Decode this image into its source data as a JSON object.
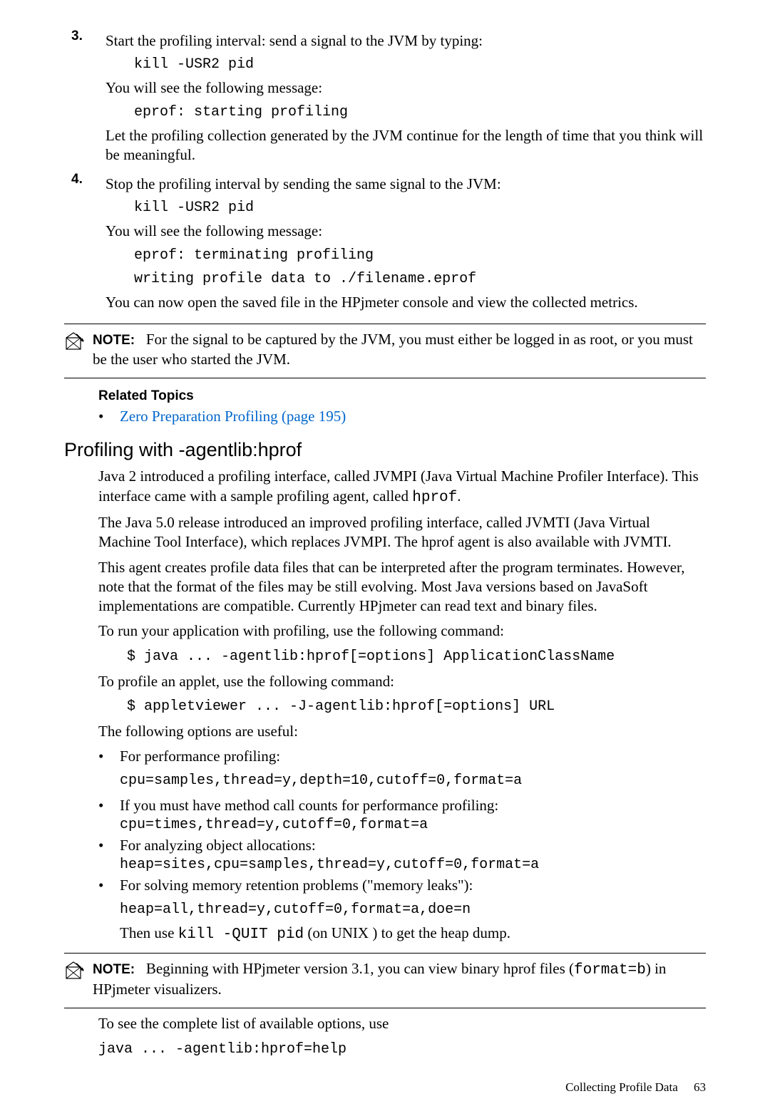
{
  "steps": {
    "s3": {
      "num": "3.",
      "intro": "Start the profiling interval: send a signal to the JVM by typing:",
      "code1": "kill -USR2 pid",
      "msg_intro": "You will see the following message:",
      "code2": "eprof: starting profiling",
      "tail": "Let the profiling collection generated by the JVM continue for the length of time that you think will be meaningful."
    },
    "s4": {
      "num": "4.",
      "intro": "Stop the profiling interval by sending the same signal to the JVM:",
      "code1": "kill -USR2 pid",
      "msg_intro": "You will see the following message:",
      "code2": "eprof: terminating profiling",
      "code3": "writing profile data to ./filename.eprof",
      "tail": "You can now open the saved file in the HPjmeter console and view the collected metrics."
    }
  },
  "note1": {
    "label": "NOTE:",
    "text": "For the signal to be captured by the JVM, you must either be logged in as root, or you must be the user who started the JVM."
  },
  "related": {
    "heading": "Related Topics",
    "link": "Zero Preparation Profiling (page 195)"
  },
  "section": {
    "title": "Profiling with -agentlib:hprof",
    "p1a": "Java 2 introduced a profiling interface, called JVMPI (Java Virtual Machine Profiler Interface). This interface came with a sample profiling agent, called ",
    "p1b": "hprof",
    "p1c": ".",
    "p2": "The Java 5.0 release introduced an improved profiling interface, called JVMTI (Java Virtual Machine Tool Interface), which replaces JVMPI. The hprof agent is also available with JVMTI.",
    "p3": "This agent creates profile data files that can be interpreted after the program terminates. However, note that the format of the files may be still evolving. Most Java versions based on JavaSoft implementations are compatible. Currently HPjmeter can read text and binary files.",
    "p4": "To run your application with profiling, use the following command:",
    "code1": "$ java ... -agentlib:hprof[=options] ApplicationClassName",
    "p5": "To profile an applet, use the following command:",
    "code2": "$ appletviewer ... -J-agentlib:hprof[=options] URL",
    "p6": "The following options are useful:",
    "bullets": {
      "b1": {
        "text": "For performance profiling:",
        "code": "cpu=samples,thread=y,depth=10,cutoff=0,format=a"
      },
      "b2": {
        "text": "If you must have method call counts for performance profiling:",
        "code": "cpu=times,thread=y,cutoff=0,format=a"
      },
      "b3": {
        "text": "For analyzing object allocations:",
        "code": "heap=sites,cpu=samples,thread=y,cutoff=0,format=a"
      },
      "b4": {
        "text": "For solving memory retention problems (\"memory leaks\"):",
        "code": "heap=all,thread=y,cutoff=0,format=a,doe=n",
        "tail_a": "Then use ",
        "tail_b": "kill -QUIT pid",
        "tail_c": " (on UNIX ) to get the heap dump."
      }
    }
  },
  "note2": {
    "label": "NOTE:",
    "text_a": "Beginning with HPjmeter version 3.1, you can view binary hprof files (",
    "text_b": "format=b",
    "text_c": ") in HPjmeter visualizers."
  },
  "closing": {
    "p": "To see the complete list of available options, use",
    "code": "java ... -agentlib:hprof=help"
  },
  "footer": {
    "title": "Collecting Profile Data",
    "page": "63"
  }
}
